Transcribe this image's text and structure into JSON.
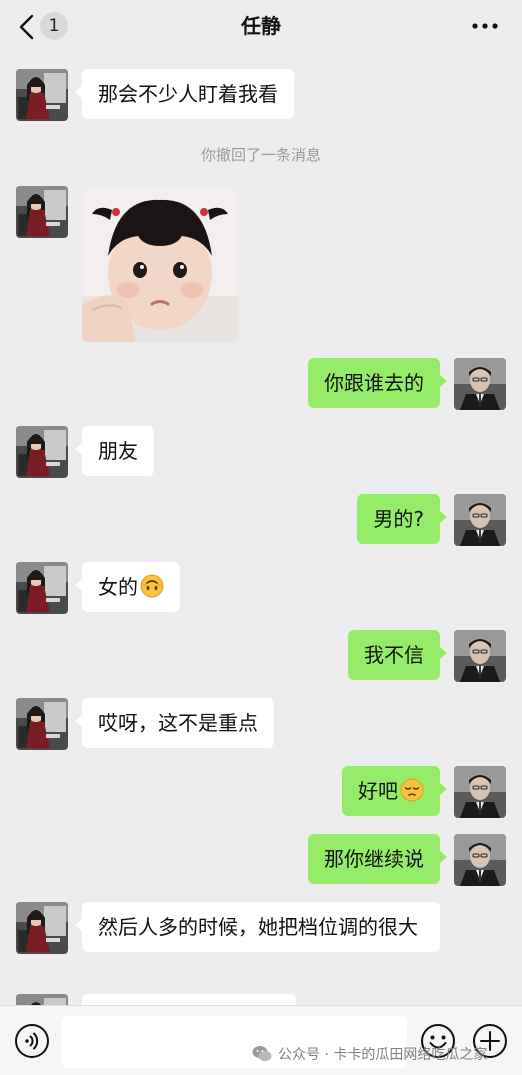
{
  "header": {
    "back_badge": "1",
    "title": "任静",
    "back_icon": "chevron-left-icon",
    "more_icon": "ellipsis-icon"
  },
  "messages": [
    {
      "side": "in",
      "text": "那会不少人盯着我看"
    },
    {
      "type": "system",
      "text": "你撤回了一条消息"
    },
    {
      "side": "in",
      "type": "sticker",
      "description_icon": "toddler-sticker-image"
    },
    {
      "side": "out",
      "text": "你跟谁去的"
    },
    {
      "side": "in",
      "text": "朋友"
    },
    {
      "side": "out",
      "text": "男的?"
    },
    {
      "side": "in",
      "text": "女的",
      "emoji": "upside-down-smile-emoji"
    },
    {
      "side": "out",
      "text": "我不信"
    },
    {
      "side": "in",
      "text": "哎呀，这不是重点"
    },
    {
      "side": "out",
      "text": "好吧",
      "emoji": "pensive-face-emoji"
    },
    {
      "side": "out",
      "text": "那你继续说"
    },
    {
      "side": "in",
      "text": "然后人多的时候，她把档位调的很大"
    }
  ],
  "input_bar": {
    "voice_icon": "voice-icon",
    "emoji_icon": "smiley-icon",
    "plus_icon": "plus-circle-icon",
    "input_value": ""
  },
  "watermark": {
    "text": "公众号 · 卡卡的瓜田网络吃瓜之家",
    "icon": "wechat-logo-icon"
  },
  "colors": {
    "background": "#ededed",
    "incoming_bubble": "#ffffff",
    "outgoing_bubble": "#95ec69",
    "system_text": "#9a9a9a"
  }
}
